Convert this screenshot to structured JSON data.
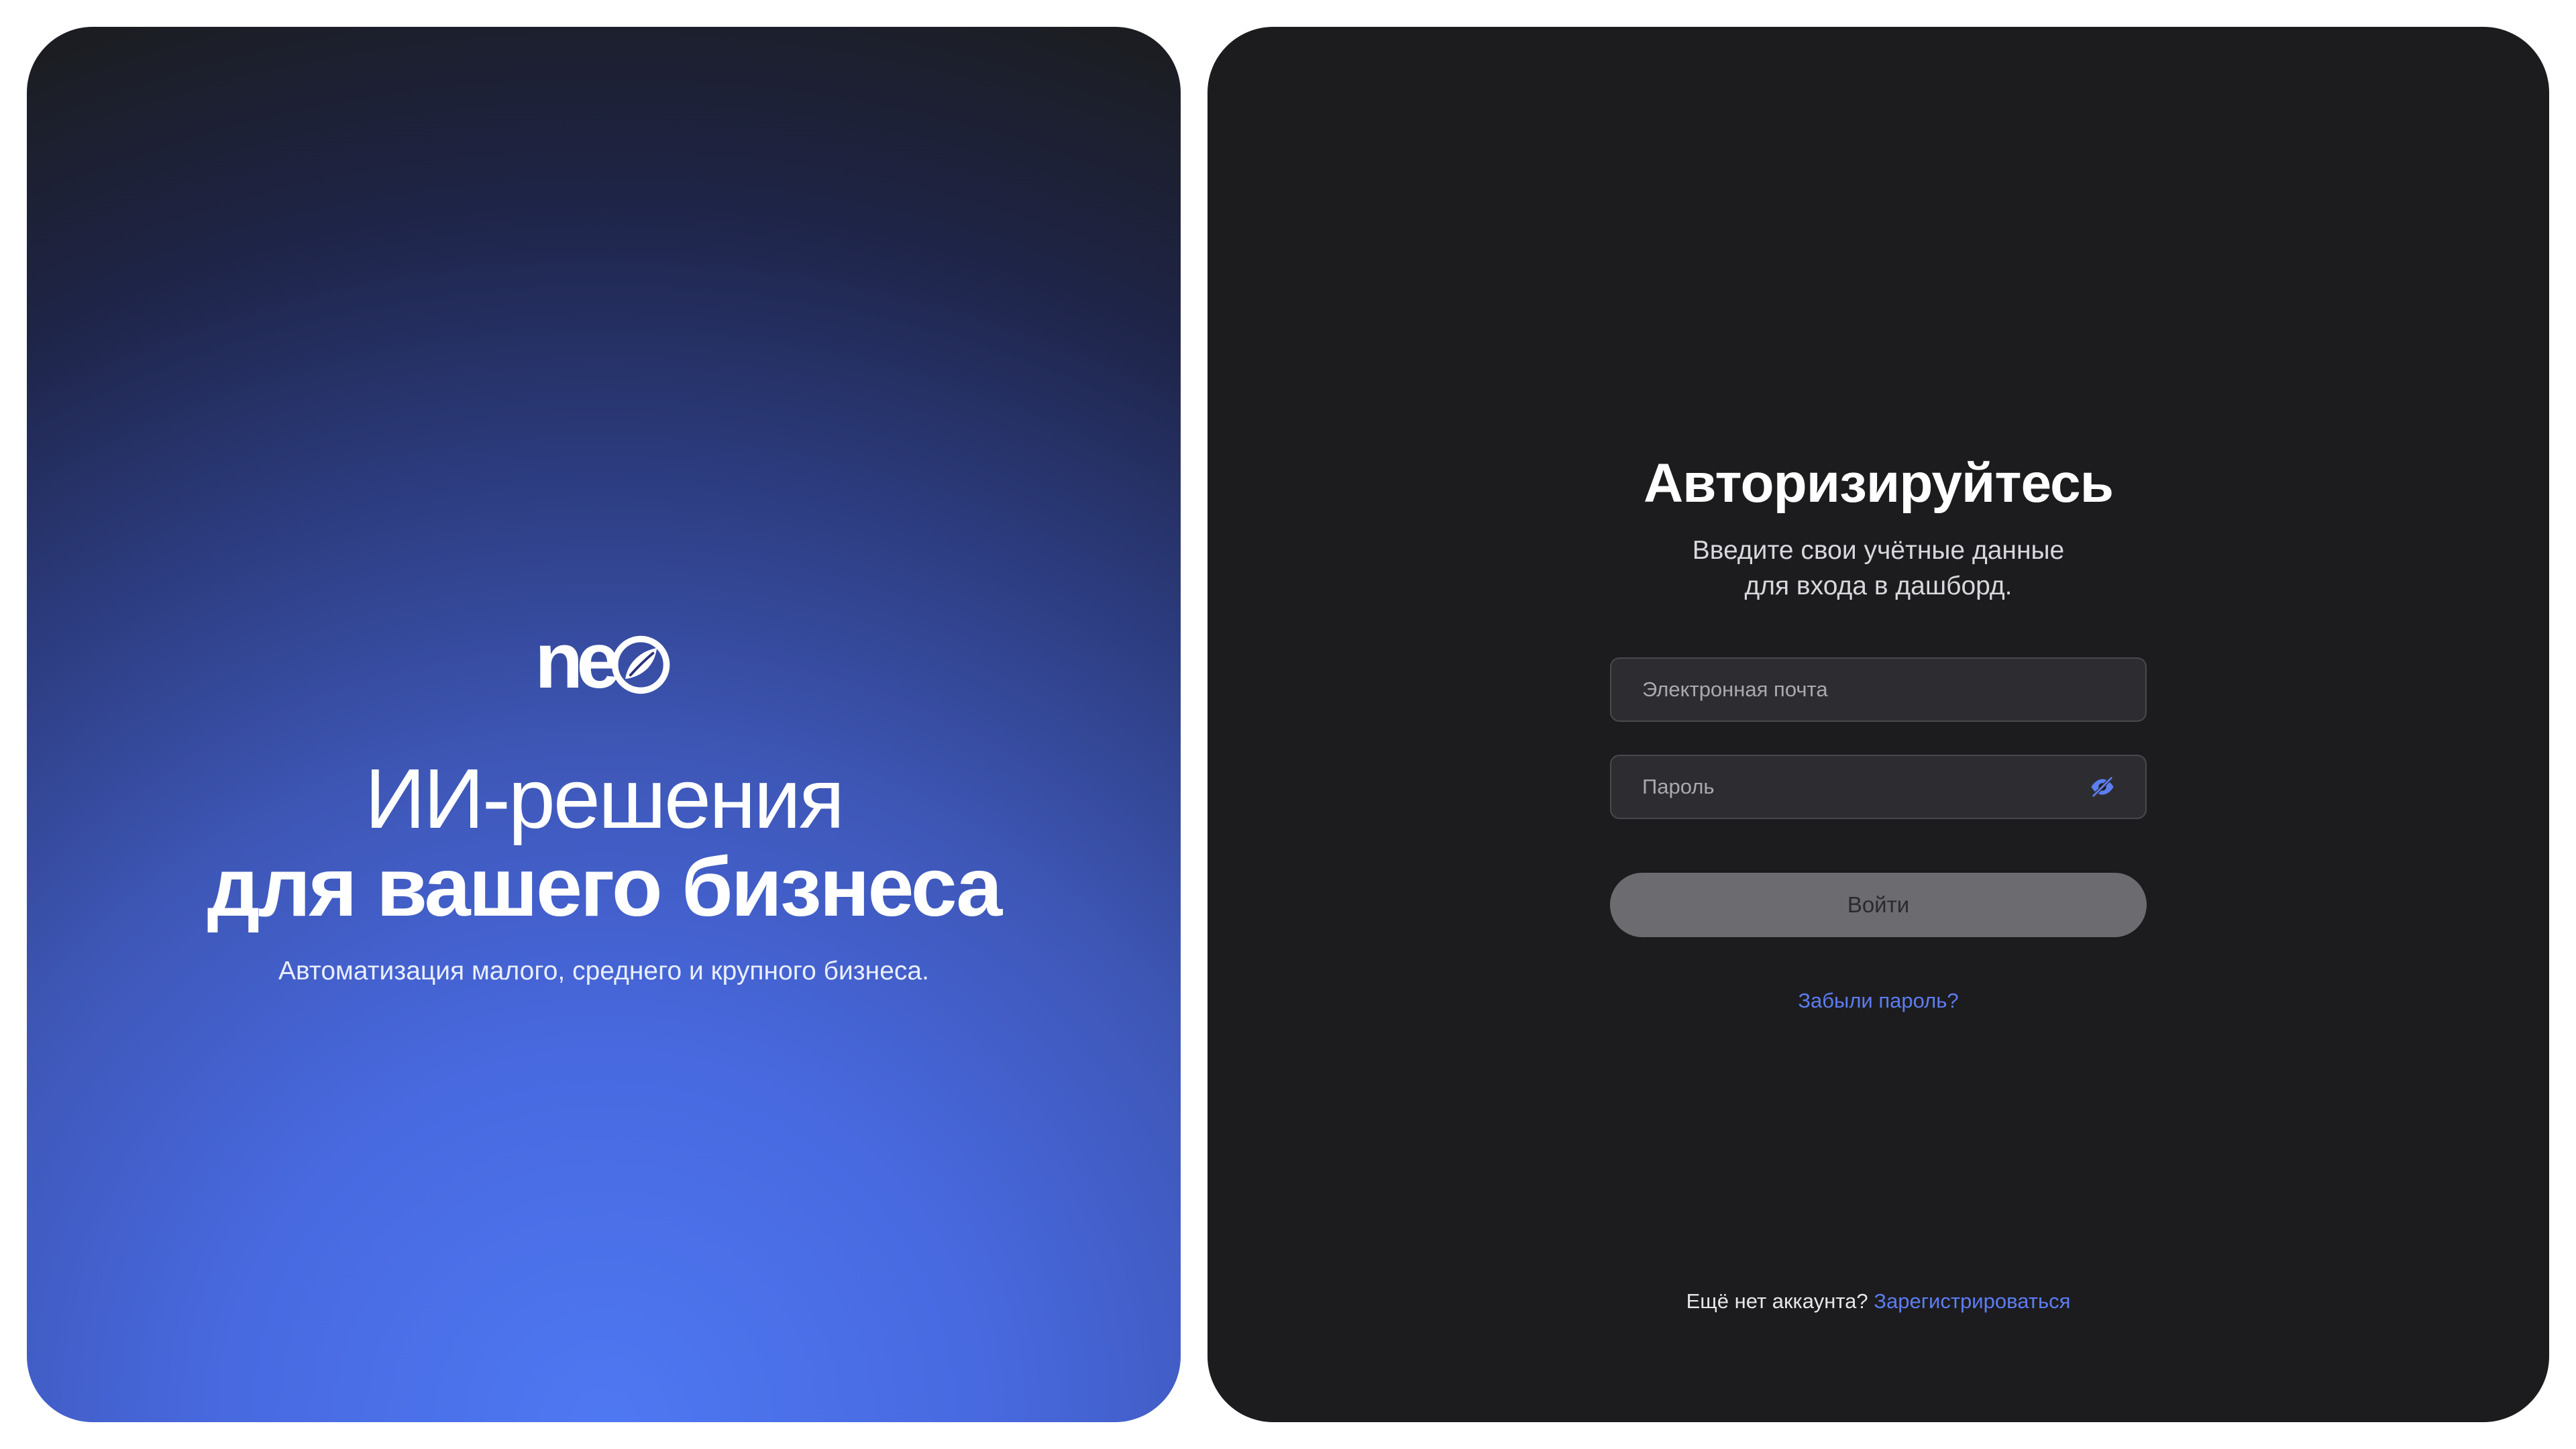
{
  "left_panel": {
    "logo": {
      "text": "ne",
      "mark_icon": "circle-leaf-icon",
      "color": "#ffffff"
    },
    "headline_line1": "ИИ-решения",
    "headline_line2": "для вашего бизнеса",
    "subtitle": "Автоматизация малого, среднего и крупного бизнеса.",
    "gradient_colors": [
      "#1c1d22",
      "#2b3a7b",
      "#4e78f2"
    ]
  },
  "auth": {
    "title": "Авторизируйтесь",
    "subtitle_line1": "Введите свои учётные данные",
    "subtitle_line2": "для входа в дашборд.",
    "email": {
      "placeholder": "Электронная почта",
      "value": ""
    },
    "password": {
      "placeholder": "Пароль",
      "value": "",
      "toggle_icon": "eye-hidden-icon"
    },
    "login_button_label": "Войти",
    "forgot_password_label": "Забыли пароль?",
    "register_prompt": "Ещё нет аккаунта?",
    "register_link_label": "Зарегистрироваться"
  },
  "colors": {
    "panel_dark": "#1c1c1f",
    "accent_link": "#5d7df0",
    "button_disabled": "#6c6c70"
  }
}
